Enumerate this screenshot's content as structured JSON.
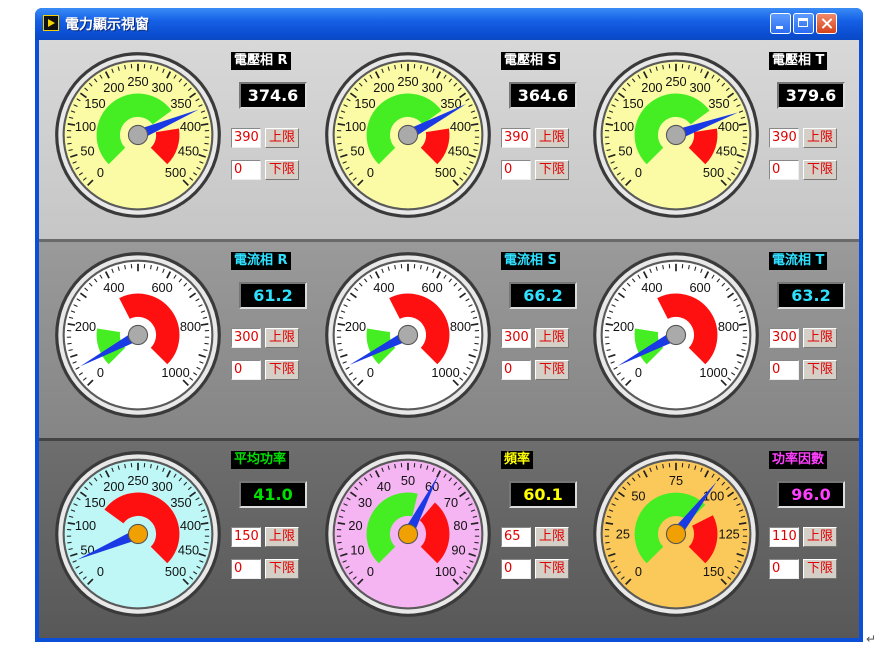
{
  "window": {
    "title": "電力顯示視窗",
    "title_color": "#ffffff",
    "titlebar_color": "#0b4ed2"
  },
  "voltage": [
    {
      "label": "電壓相 R",
      "value": "374.6",
      "upper": "390",
      "lower": "0",
      "upper_label": "上限",
      "lower_label": "下限",
      "needle_value": 374.6
    },
    {
      "label": "電壓相 S",
      "value": "364.6",
      "upper": "390",
      "lower": "0",
      "upper_label": "上限",
      "lower_label": "下限",
      "needle_value": 364.6
    },
    {
      "label": "電壓相 T",
      "value": "379.6",
      "upper": "390",
      "lower": "0",
      "upper_label": "上限",
      "lower_label": "下限",
      "needle_value": 379.6
    }
  ],
  "current": [
    {
      "label": "電流相 R",
      "value": "61.2",
      "upper": "300",
      "lower": "0",
      "upper_label": "上限",
      "lower_label": "下限",
      "needle_value": 61.2
    },
    {
      "label": "電流相 S",
      "value": "66.2",
      "upper": "300",
      "lower": "0",
      "upper_label": "上限",
      "lower_label": "下限",
      "needle_value": 66.2
    },
    {
      "label": "電流相 T",
      "value": "63.2",
      "upper": "300",
      "lower": "0",
      "upper_label": "上限",
      "lower_label": "下限",
      "needle_value": 63.2
    }
  ],
  "power": [
    {
      "label": "平均功率",
      "value": "41.0",
      "upper": "150",
      "lower": "0",
      "upper_label": "上限",
      "lower_label": "下限",
      "needle_value": 41.0
    },
    {
      "label": "頻率",
      "value": "60.1",
      "upper": "65",
      "lower": "0",
      "upper_label": "上限",
      "lower_label": "下限",
      "needle_value": 60.1
    },
    {
      "label": "功率因數",
      "value": "96.0",
      "upper": "110",
      "lower": "0",
      "upper_label": "上限",
      "lower_label": "下限",
      "needle_value": 96.0
    }
  ],
  "gauges": {
    "voltage": {
      "min": 0,
      "max": 500,
      "ticks": [
        0,
        50,
        100,
        150,
        200,
        250,
        300,
        350,
        400,
        450,
        500
      ],
      "face": "#fbfba6",
      "green_range": [
        0,
        350
      ],
      "red_range": [
        400,
        500
      ],
      "needle_color": "#1a3ae6",
      "hub_color": "#aaaaaa"
    },
    "current": {
      "min": 0,
      "max": 1000,
      "ticks": [
        0,
        200,
        400,
        600,
        800,
        1000
      ],
      "face": "#ffffff",
      "green_range": [
        0,
        200
      ],
      "red_range": [
        400,
        1000
      ],
      "needle_color": "#1a3ae6",
      "hub_color": "#aaaaaa"
    },
    "power": {
      "min": 0,
      "max": 500,
      "ticks": [
        0,
        50,
        100,
        150,
        200,
        250,
        300,
        350,
        400,
        450,
        500
      ],
      "face": "#bff7f7",
      "green_range": [
        0,
        0
      ],
      "red_range": [
        150,
        500
      ],
      "needle_color": "#1a3ae6",
      "hub_color": "#f0a000"
    },
    "frequency": {
      "min": 0,
      "max": 100,
      "ticks": [
        0,
        10,
        20,
        30,
        40,
        50,
        60,
        70,
        80,
        90,
        100
      ],
      "face": "#f5b4f2",
      "green_range": [
        0,
        55
      ],
      "red_range": [
        65,
        100
      ],
      "needle_color": "#1a3ae6",
      "hub_color": "#f0a000"
    },
    "pf": {
      "min": 0,
      "max": 150,
      "ticks": [
        0,
        25,
        50,
        75,
        100,
        125,
        150
      ],
      "face": "#fbc85a",
      "green_range": [
        0,
        100
      ],
      "red_range": [
        110,
        150
      ],
      "needle_color": "#1a3ae6",
      "hub_color": "#f0a000"
    }
  },
  "colors": {
    "voltage_label": "#ffffff",
    "voltage_value": "#ffffff",
    "current_label": "#30e0ff",
    "current_value": "#30e0ff",
    "power_label": "#00e000",
    "freq_label": "#ffff00",
    "pf_label": "#ff40ff",
    "limit_text": "#e00000"
  }
}
